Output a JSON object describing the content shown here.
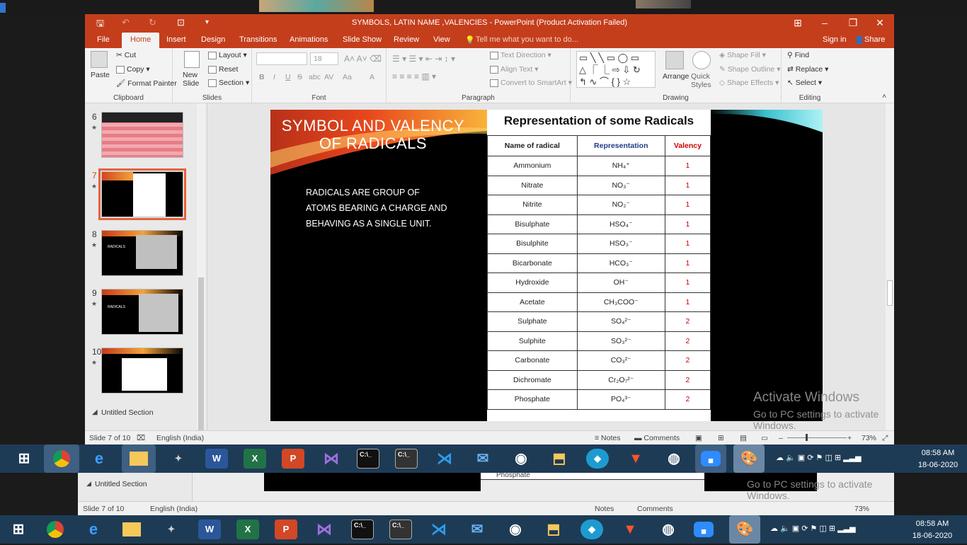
{
  "window": {
    "title": "SYMBOLS, LATIN NAME ,VALENCIES  -  PowerPoint (Product Activation Failed)",
    "sign_in": "Sign in",
    "share": "Share"
  },
  "tabs": [
    "File",
    "Home",
    "Insert",
    "Design",
    "Transitions",
    "Animations",
    "Slide Show",
    "Review",
    "View"
  ],
  "tell_me": "Tell me what you want to do...",
  "ribbon": {
    "clipboard": {
      "label": "Clipboard",
      "paste": "Paste",
      "cut": "Cut",
      "copy": "Copy",
      "format_painter": "Format Painter"
    },
    "slides": {
      "label": "Slides",
      "new_slide": "New\nSlide",
      "layout": "Layout",
      "reset": "Reset",
      "section": "Section"
    },
    "font": {
      "label": "Font",
      "font_size": "18",
      "bold": "B",
      "italic": "I",
      "underline": "U",
      "strike": "S",
      "shadow": "abc",
      "spacing": "AV",
      "case": "Aa",
      "color": "A"
    },
    "paragraph": {
      "label": "Paragraph",
      "text_direction": "Text Direction",
      "align_text": "Align Text",
      "smartart": "Convert to SmartArt"
    },
    "drawing": {
      "label": "Drawing",
      "arrange": "Arrange",
      "quick_styles": "Quick\nStyles",
      "shape_fill": "Shape Fill",
      "shape_outline": "Shape Outline",
      "shape_effects": "Shape Effects"
    },
    "editing": {
      "label": "Editing",
      "find": "Find",
      "replace": "Replace",
      "select": "Select"
    }
  },
  "slides_panel": {
    "items": [
      {
        "num": "6"
      },
      {
        "num": "7"
      },
      {
        "num": "8"
      },
      {
        "num": "9"
      },
      {
        "num": "10"
      }
    ],
    "section": "Untitled Section",
    "thumb_labels": {
      "8": "RADICALS",
      "9": "RADICALS"
    }
  },
  "slide": {
    "title": "SYMBOL AND VALENCY OF RADICALS",
    "body": "RADICALS ARE GROUP OF  ATOMS BEARING A CHARGE AND BEHAVING AS A SINGLE UNIT.",
    "table_title": "Representation of some Radicals",
    "headers": [
      "Name of radical",
      "Representation",
      "Valency"
    ],
    "rows": [
      [
        "Ammonium",
        "NH₄⁺",
        "1"
      ],
      [
        "Nitrate",
        "NO₃⁻",
        "1"
      ],
      [
        "Nitrite",
        "NO₂⁻",
        "1"
      ],
      [
        "Bisulphate",
        "HSO₄⁻",
        "1"
      ],
      [
        "Bisulphite",
        "HSO₃⁻",
        "1"
      ],
      [
        "Bicarbonate",
        "HCO₃⁻",
        "1"
      ],
      [
        "Hydroxide",
        "OH⁻",
        "1"
      ],
      [
        "Acetate",
        "CH₃COO⁻",
        "1"
      ],
      [
        "Sulphate",
        "SO₄²⁻",
        "2"
      ],
      [
        "Sulphite",
        "SO₃²⁻",
        "2"
      ],
      [
        "Carbonate",
        "CO₃²⁻",
        "2"
      ],
      [
        "Dichromate",
        "Cr₂O₇²⁻",
        "2"
      ],
      [
        "Phosphate",
        "PO₄³⁻",
        "2"
      ]
    ]
  },
  "status": {
    "slide": "Slide 7 of 10",
    "language": "English (India)",
    "notes": "Notes",
    "comments": "Comments",
    "zoom": "73%"
  },
  "watermark": {
    "line1": "Activate Windows",
    "line2": "Go to PC settings to activate Windows."
  },
  "taskbar": {
    "time": "08:58 AM",
    "date": "18-06-2020"
  },
  "ghost": {
    "row_text": "Phosphate",
    "section": "Untitled Section"
  },
  "colors": {
    "accent": "#c43e1c",
    "selection": "#e5623b",
    "taskbar": "#1e3b55"
  }
}
